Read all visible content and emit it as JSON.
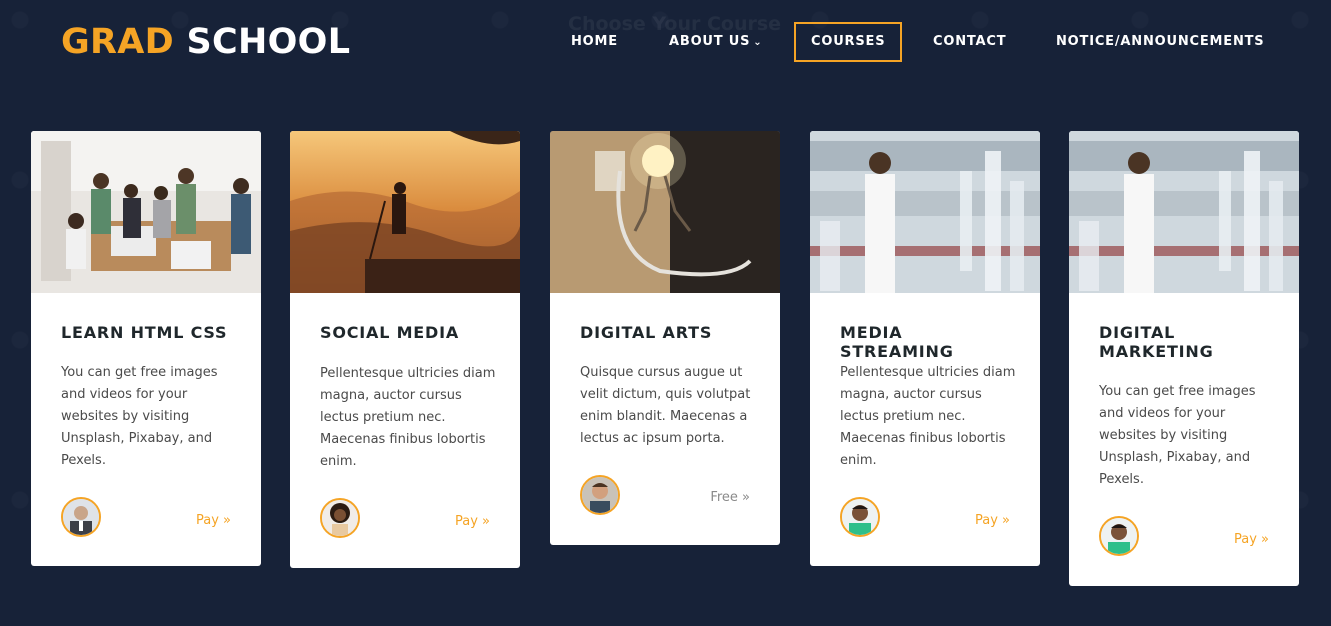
{
  "brand": {
    "part1": "GRAD",
    "part2": "SCHOOL"
  },
  "background_heading": "Choose Your Course",
  "nav": {
    "home": "HOME",
    "about": "ABOUT US",
    "courses": "COURSES",
    "contact": "CONTACT",
    "notice": "NOTICE/ANNOUNCEMENTS"
  },
  "colors": {
    "accent": "#f5a425",
    "background": "#172238"
  },
  "courses": [
    {
      "title": "LEARN HTML CSS",
      "description": "You can get free images and videos for your websites by visiting Unsplash, Pixabay, and Pexels.",
      "price_label": "Pay »",
      "image": "students-at-table-photo",
      "avatar": "man-in-suit-avatar"
    },
    {
      "title": "SOCIAL MEDIA",
      "description": "Pellentesque ultricies diam magna, auctor cursus lectus pretium nec. Maecenas finibus lobortis enim.",
      "price_label": "Pay »",
      "image": "photographer-sunset-photo",
      "avatar": "woman-curly-hair-avatar"
    },
    {
      "title": "DIGITAL ARTS",
      "description": "Quisque cursus augue ut velit dictum, quis volutpat enim blandit. Maecenas a lectus ac ipsum porta.",
      "price_label": "Free »",
      "image": "lightbulb-figure-photo",
      "avatar": "smiling-man-avatar"
    },
    {
      "title": "MEDIA STREAMING",
      "description": "Pellentesque ultricies diam magna, auctor cursus lectus pretium nec. Maecenas finibus lobortis enim.",
      "price_label": "Pay »",
      "image": "laboratory-scientist-photo",
      "avatar": "man-green-shirt-avatar"
    },
    {
      "title": "DIGITAL MARKETING",
      "description": "You can get free images and videos for your websites by visiting Unsplash, Pixabay, and Pexels.",
      "price_label": "Pay »",
      "image": "laboratory-scientist-photo",
      "avatar": "man-green-shirt-avatar"
    }
  ]
}
